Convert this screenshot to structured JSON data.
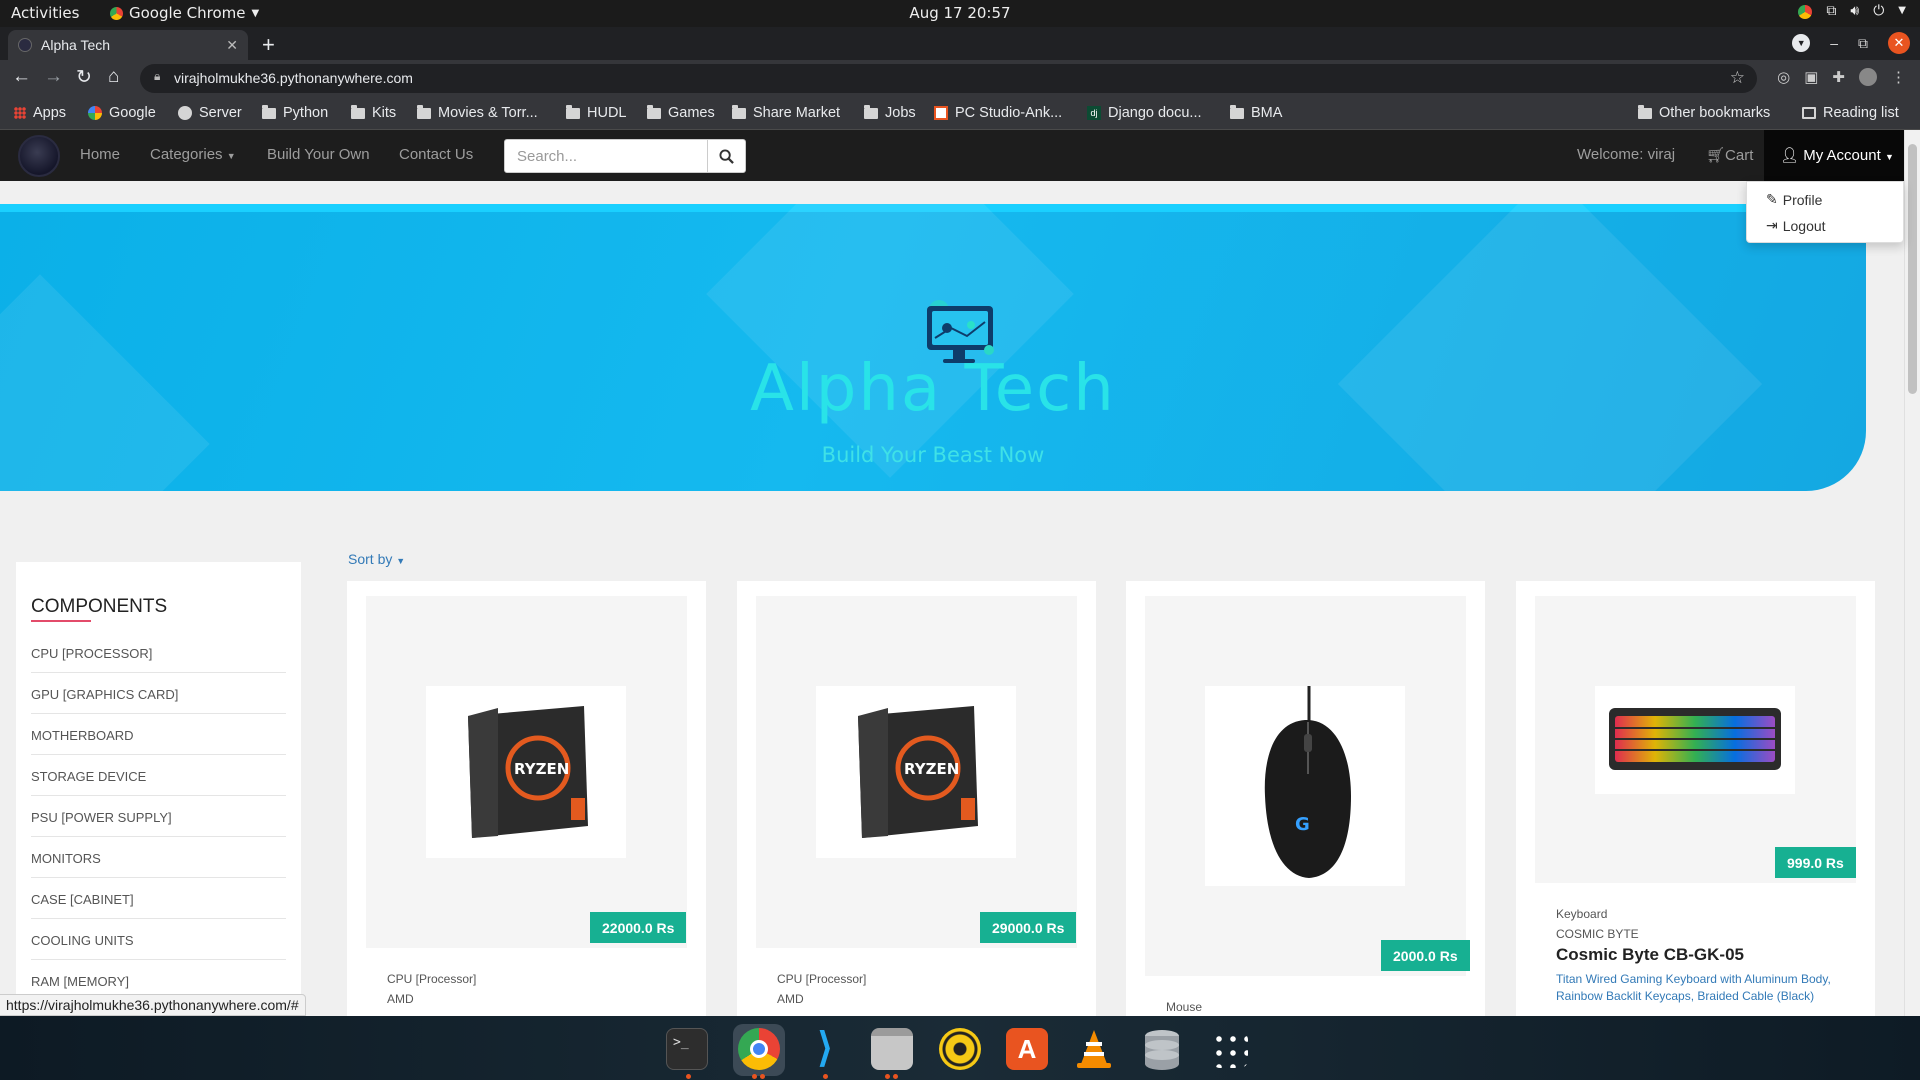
{
  "system": {
    "activities": "Activities",
    "app_name": "Google Chrome",
    "clock": "Aug 17  20:57"
  },
  "browser": {
    "tab_title": "Alpha Tech",
    "url": "virajholmukhe36.pythonanywhere.com",
    "bookmarks": [
      "Apps",
      "Google",
      "Server",
      "Python",
      "Kits",
      "Movies & Torr...",
      "HUDL",
      "Games",
      "Share Market",
      "Jobs",
      "PC Studio-Ank...",
      "Django docu...",
      "BMA"
    ],
    "other_bookmarks": "Other bookmarks",
    "reading_list": "Reading list",
    "status_url": "https://virajholmukhe36.pythonanywhere.com/#"
  },
  "site": {
    "nav": {
      "home": "Home",
      "categories": "Categories",
      "build": "Build Your Own",
      "contact": "Contact Us",
      "search_placeholder": "Search...",
      "welcome": "Welcome: viraj",
      "cart": "Cart",
      "account": "My Account"
    },
    "account_menu": [
      "Profile",
      "Logout"
    ],
    "hero": {
      "title": "Alpha Tech",
      "tagline": "Build Your Beast Now"
    },
    "sidebar": {
      "heading": "COMPONENTS",
      "categories": [
        "CPU [PROCESSOR]",
        "GPU [GRAPHICS CARD]",
        "MOTHERBOARD",
        "STORAGE DEVICE",
        "PSU [POWER SUPPLY]",
        "MONITORS",
        "CASE [CABINET]",
        "COOLING UNITS",
        "RAM [MEMORY]"
      ]
    },
    "sort_label": "Sort by",
    "products": [
      {
        "type": "CPU [Processor]",
        "brand": "AMD",
        "price": "22000.0 Rs"
      },
      {
        "type": "CPU [Processor]",
        "brand": "AMD",
        "price": "29000.0 Rs"
      },
      {
        "type": "Mouse",
        "price": "2000.0 Rs"
      },
      {
        "type": "Keyboard",
        "brand": "COSMIC BYTE",
        "name": "Cosmic Byte CB-GK-05",
        "description": "Titan Wired Gaming Keyboard with Aluminum Body, Rainbow Backlit Keycaps, Braided Cable (Black)",
        "price": "999.0 Rs"
      }
    ]
  },
  "colors": {
    "hero_blue": "#14b4ec",
    "hero_text": "#29e3e8",
    "price_badge": "#17b092",
    "nav_bg": "#1d1d1d",
    "accent_underline": "#e34b6a"
  }
}
